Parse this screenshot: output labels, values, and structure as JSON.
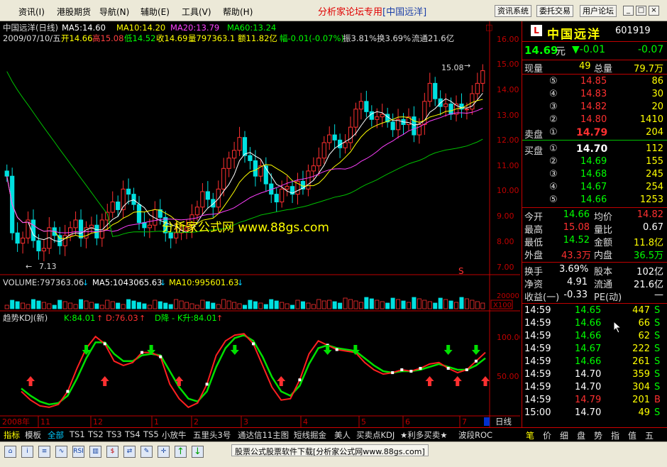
{
  "menu": {
    "items": [
      "资讯(I)",
      "港股期货",
      "导航(N)",
      "辅助(E)",
      "工具(V)",
      "帮助(H)"
    ],
    "brand": "分析家论坛专用",
    "brand_tag": "[中国远洋]",
    "buttons": [
      "资讯系统",
      "委托交易",
      "用户论坛"
    ],
    "window_controls": [
      "_",
      "□",
      "×"
    ]
  },
  "chart_header": {
    "title": "中国远洋(日线)",
    "ma5": "MA5:14.60",
    "ma10": "MA10:14.20",
    "ma20": "MA20:13.79",
    "ma60": "MA60:13.24",
    "info_date": "2009/07/10/五",
    "open": "开14.66",
    "high": "高15.08",
    "low": "低14.52",
    "close": "收14.69",
    "volume": "量797363.1",
    "amount": "额11.82亿",
    "change": "幅-0.01(-0.07%)",
    "amplitude": "振3.81%",
    "turnover": "换3.69%",
    "float": "流通21.6亿"
  },
  "price_axis": [
    "16.00",
    "15.00",
    "14.00",
    "13.00",
    "12.00",
    "11.00",
    "10.00",
    "9.00",
    "8.00",
    "7.00"
  ],
  "annotations": {
    "high_label": "15.08",
    "low_label": "7.13",
    "watermark": "分析家公式网 www.88gs.com",
    "s_mark": "S"
  },
  "volume_header": {
    "volume": "VOLUME:797363.06",
    "ma5": "MA5:1043065.63",
    "ma10": "MA10:995601.63",
    "axis_top": "20000",
    "unit": "X100"
  },
  "kdj_header": {
    "title": "趋势KDJ(新)",
    "k": "K:84.01",
    "d": "D:76.03",
    "state": "D降 - K升:84.01"
  },
  "kdj_axis": [
    "100.00",
    "50.00"
  ],
  "date_axis": {
    "year": "2008年",
    "months": [
      "11",
      "12",
      "1",
      "2",
      "3",
      "4",
      "5",
      "6",
      "7"
    ],
    "period": "日线"
  },
  "chart_data": {
    "type": "line",
    "candles_close": [
      10.6,
      8.4,
      8.0,
      8.2,
      8.9,
      8.1,
      7.7,
      7.8,
      8.6,
      8.3,
      7.9,
      8.3,
      8.6,
      8.9,
      8.2,
      8.6,
      8.7,
      8.2,
      8.9,
      9.2,
      9.6,
      9.3,
      10.1,
      9.9,
      9.5,
      8.8,
      8.6,
      8.7,
      9.3,
      9.0,
      8.4,
      8.2,
      8.4,
      8.5,
      8.6,
      9.1,
      9.4,
      10.0,
      9.7,
      9.4,
      10.1,
      10.9,
      11.3,
      11.6,
      12.1,
      11.4,
      11.2,
      10.6,
      11.0,
      10.3,
      9.9,
      9.6,
      10.1,
      10.2,
      9.9,
      10.4,
      10.1,
      10.8,
      11.0,
      11.3,
      11.9,
      12.2,
      12.0,
      11.7,
      11.9,
      12.5,
      13.2,
      13.5,
      13.1,
      12.8,
      12.9,
      13.0,
      12.7,
      12.4,
      12.8,
      12.6,
      12.9,
      12.2,
      12.6,
      13.5,
      14.2,
      13.6,
      13.3,
      13.4,
      13.0,
      13.4,
      13.2,
      13.2,
      13.8,
      14.2,
      14.69
    ],
    "kdj_k": [
      30,
      18,
      10,
      8,
      12,
      30,
      62,
      90,
      106,
      96,
      72,
      66,
      70,
      84,
      84,
      78,
      40,
      20,
      8,
      14,
      40,
      80,
      100,
      108,
      110,
      96,
      66,
      36,
      18,
      20,
      46,
      82,
      100,
      94,
      88,
      86,
      84,
      70,
      60,
      54,
      56,
      60,
      58,
      62,
      68,
      70,
      62,
      56,
      60,
      72,
      84
    ],
    "kdj_d": [
      34,
      24,
      16,
      12,
      14,
      24,
      48,
      76,
      98,
      98,
      82,
      72,
      72,
      80,
      82,
      80,
      58,
      36,
      20,
      16,
      30,
      64,
      90,
      104,
      108,
      100,
      78,
      50,
      30,
      24,
      38,
      68,
      90,
      94,
      90,
      88,
      86,
      76,
      66,
      58,
      56,
      58,
      58,
      60,
      64,
      68,
      64,
      60,
      60,
      66,
      76
    ],
    "ylim": [
      7.0,
      16.0
    ],
    "kdj_ylim": [
      0,
      120
    ]
  },
  "panel": {
    "logo": "L",
    "stock_name": "中国远洋",
    "code": "601919",
    "price": "14.69",
    "price_unit": "元",
    "change_arrow": "▼-0.01",
    "change_pct": "-0.07",
    "now_vol_label": "现量",
    "now_vol": "49",
    "total_vol_label": "总量",
    "total_vol": "79.7万",
    "sell_label": "卖盘",
    "buy_label": "买盘",
    "asks": [
      {
        "lvl": "⑤",
        "price": "14.85",
        "qty": "86"
      },
      {
        "lvl": "④",
        "price": "14.83",
        "qty": "30"
      },
      {
        "lvl": "③",
        "price": "14.82",
        "qty": "20"
      },
      {
        "lvl": "②",
        "price": "14.80",
        "qty": "1410"
      },
      {
        "lvl": "①",
        "price": "14.79",
        "qty": "204"
      }
    ],
    "bids": [
      {
        "lvl": "①",
        "price": "14.70",
        "qty": "112"
      },
      {
        "lvl": "②",
        "price": "14.69",
        "qty": "155"
      },
      {
        "lvl": "③",
        "price": "14.68",
        "qty": "245"
      },
      {
        "lvl": "④",
        "price": "14.67",
        "qty": "254"
      },
      {
        "lvl": "⑤",
        "price": "14.66",
        "qty": "1253"
      }
    ],
    "stats": [
      {
        "l1": "今开",
        "v1": "14.66",
        "l2": "均价",
        "v2": "14.82"
      },
      {
        "l1": "最高",
        "v1": "15.08",
        "l2": "量比",
        "v2": "0.67"
      },
      {
        "l1": "最低",
        "v1": "14.52",
        "l2": "金额",
        "v2": "11.8亿"
      },
      {
        "l1": "外盘",
        "v1": "43.3万",
        "l2": "内盘",
        "v2": "36.5万"
      }
    ],
    "fund": [
      {
        "l1": "换手",
        "v1": "3.69%",
        "l2": "股本",
        "v2": "102亿"
      },
      {
        "l1": "净资",
        "v1": "4.91",
        "l2": "流通",
        "v2": "21.6亿"
      },
      {
        "l1": "收益(一)",
        "v1": "-0.33",
        "l2": "PE(动)",
        "v2": "—"
      }
    ],
    "ticks": [
      {
        "t": "14:59",
        "p": "14.65",
        "v": "447",
        "s": "S"
      },
      {
        "t": "14:59",
        "p": "14.66",
        "v": "66",
        "s": "S"
      },
      {
        "t": "14:59",
        "p": "14.66",
        "v": "62",
        "s": "S"
      },
      {
        "t": "14:59",
        "p": "14.67",
        "v": "222",
        "s": "S"
      },
      {
        "t": "14:59",
        "p": "14.66",
        "v": "261",
        "s": "S"
      },
      {
        "t": "14:59",
        "p": "14.70",
        "v": "359",
        "s": "S"
      },
      {
        "t": "14:59",
        "p": "14.70",
        "v": "304",
        "s": "S"
      },
      {
        "t": "14:59",
        "p": "14.79",
        "v": "201",
        "s": "B"
      },
      {
        "t": "15:00",
        "p": "14.70",
        "v": "49",
        "s": "S"
      }
    ]
  },
  "tabs": [
    "指标",
    "模板",
    "全部",
    "TS1",
    "TS2",
    "TS3",
    "TS4",
    "TS5",
    "小放牛",
    "五里头3号",
    "通达信11主图",
    "短线掘金",
    "美人",
    "买卖点KDJ",
    "★利多买卖★",
    "波段ROC"
  ],
  "right_tabs": [
    "笔",
    "价",
    "细",
    "盘",
    "势",
    "指",
    "值",
    "五"
  ],
  "toolbar": {
    "icons": [
      "home-icon",
      "info-icon",
      "list-icon",
      "chart-icon",
      "rsi-icon",
      "bar-icon",
      "dollar-icon",
      "swap-icon",
      "edit-icon",
      "move-icon",
      "up-arrow-icon",
      "down-arrow-icon"
    ],
    "icon_glyphs": [
      "⌂",
      "i",
      "≡",
      "∿",
      "RSI",
      "▥",
      "$",
      "⇄",
      "✎",
      "✛",
      "↑",
      "↓"
    ],
    "status": "股票公式股票软件下载[分析家公式网www.88gs.com]"
  }
}
